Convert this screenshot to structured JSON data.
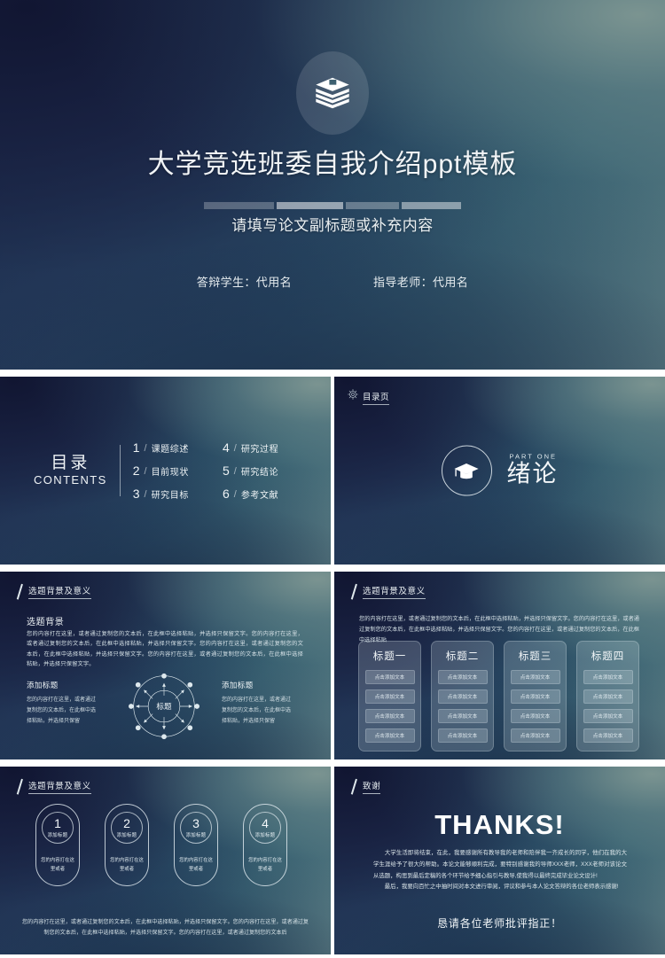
{
  "theme": {
    "accent_dark": "#1b2349",
    "accent_mid": "#2f5870",
    "accent_light": "#5c7e84",
    "text_primary": "#f2f5f7"
  },
  "title_slide": {
    "icon": "book-stack-icon",
    "title": "大学竞选班委自我介绍ppt模板",
    "subtitle": "请填写论文副标题或补充内容",
    "student_label": "答辩学生：代用名",
    "advisor_label": "指导老师：代用名"
  },
  "contents_slide": {
    "heading_cn": "目录",
    "heading_en": "CONTENTS",
    "items_left": [
      {
        "num": "1",
        "label": "课题综述"
      },
      {
        "num": "2",
        "label": "目前现状"
      },
      {
        "num": "3",
        "label": "研究目标"
      }
    ],
    "items_right": [
      {
        "num": "4",
        "label": "研究过程"
      },
      {
        "num": "5",
        "label": "研究结论"
      },
      {
        "num": "6",
        "label": "参考文献"
      }
    ]
  },
  "section_slide": {
    "badge": "目录页",
    "badge_icon": "compass-icon",
    "icon": "graduation-cap-icon",
    "part_en": "PART ONE",
    "part_cn": "绪论"
  },
  "content_slide": {
    "header": "选题背景及意义",
    "subheading": "选题背景",
    "paragraph": "您的内容打在这里，或者通过复制您的文本后，在此框中选择粘贴，并选择只保留文字。您的内容打在这里，或者通过复制您的文本后，在此框中选择粘贴，并选择只保留文字。您的内容打在这里，或者通过复制您的文本后，在此框中选择粘贴，并选择只保留文字。您的内容打在这里，或者通过复制您的文本后，在此框中选择粘贴，并选择只保留文字。",
    "ring_center": "标题",
    "left_title": "添加标题",
    "left_text": "您的内容打在这里，或者通过复制您的文本后，在此框中选择粘贴，并选择只保留",
    "right_title": "添加标题",
    "right_text": "您的内容打在这里，或者通过复制您的文本后，在此框中选择粘贴，并选择只保留"
  },
  "columns_slide": {
    "header": "选题背景及意义",
    "paragraph": "您的内容打在这里，或者通过复制您的文本后，在此框中选择粘贴，并选择只保留文字。您的内容打在这里，或者通过复制您的文本后，在此框中选择粘贴，并选择只保留文字。您的内容打在这里，或者通过复制您的文本后，在此框中选择粘贴",
    "button_label": "点击添加文本",
    "columns": [
      {
        "title": "标题一",
        "buttons": [
          "点击添加文本",
          "点击添加文本",
          "点击添加文本",
          "点击添加文本"
        ]
      },
      {
        "title": "标题二",
        "buttons": [
          "点击添加文本",
          "点击添加文本",
          "点击添加文本",
          "点击添加文本"
        ]
      },
      {
        "title": "标题三",
        "buttons": [
          "点击添加文本",
          "点击添加文本",
          "点击添加文本",
          "点击添加文本"
        ]
      },
      {
        "title": "标题四",
        "buttons": [
          "点击添加文本",
          "点击添加文本",
          "点击添加文本",
          "点击添加文本"
        ]
      }
    ]
  },
  "pills_slide": {
    "header": "选题背景及意义",
    "pills": [
      {
        "num": "1",
        "caption": "添加标题",
        "text": "您的内容打在这里或者"
      },
      {
        "num": "2",
        "caption": "添加标题",
        "text": "您的内容打在这里或者"
      },
      {
        "num": "3",
        "caption": "添加标题",
        "text": "您的内容打在这里或者"
      },
      {
        "num": "4",
        "caption": "添加标题",
        "text": "您的内容打在这里或者"
      }
    ],
    "footer": "您的内容打在这里，或者通过复制您的文本后，在此框中选择粘贴，并选择只保留文字。您的内容打在这里，或者通过复制您的文本后，在此框中选择粘贴，并选择只保留文字。您的内容打在这里，或者通过复制您的文本后"
  },
  "thanks_slide": {
    "header": "致谢",
    "title": "THANKS!",
    "paragraph_1": "大学生活即将结束，在此，我要感谢所有教导我的老师和陪伴我一齐成长的同学，他们在我的大学生涯给予了很大的帮助。本论文能够顺利完成，要特别感谢我的导师XXX老师，XXX老师对该论文从选题，构思到最后定稿的各个环节给予细心指引与教导,使我得以最终完成毕业论文设计!",
    "paragraph_2": "最后，我要向百忙之中抽时间对本文进行审阅，评议和参与本人论文答辩的各位老师表示感谢!",
    "footer": "恳请各位老师批评指正！"
  }
}
